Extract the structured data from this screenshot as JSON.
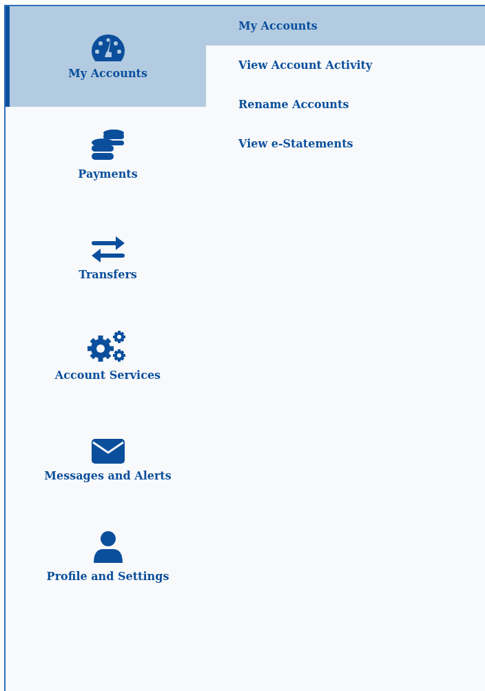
{
  "nav": [
    {
      "label": "My Accounts",
      "selected": true
    },
    {
      "label": "Payments",
      "selected": false
    },
    {
      "label": "Transfers",
      "selected": false
    },
    {
      "label": "Account Services",
      "selected": false
    },
    {
      "label": "Messages and Alerts",
      "selected": false
    },
    {
      "label": "Profile and Settings",
      "selected": false
    }
  ],
  "submenu": [
    {
      "label": "My Accounts",
      "selected": true
    },
    {
      "label": "View Account Activity",
      "selected": false
    },
    {
      "label": "Rename Accounts",
      "selected": false
    },
    {
      "label": "View e-Statements",
      "selected": false
    }
  ]
}
